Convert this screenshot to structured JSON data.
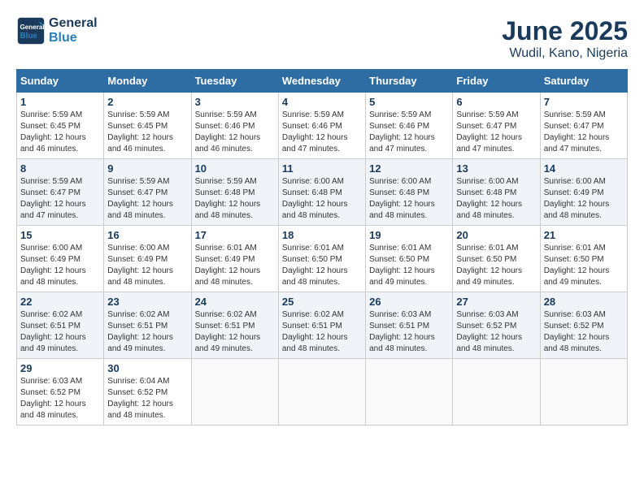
{
  "header": {
    "logo_line1": "General",
    "logo_line2": "Blue",
    "title": "June 2025",
    "subtitle": "Wudil, Kano, Nigeria"
  },
  "weekdays": [
    "Sunday",
    "Monday",
    "Tuesday",
    "Wednesday",
    "Thursday",
    "Friday",
    "Saturday"
  ],
  "weeks": [
    [
      {
        "day": "1",
        "sunrise": "5:59 AM",
        "sunset": "6:45 PM",
        "daylight": "12 hours and 46 minutes."
      },
      {
        "day": "2",
        "sunrise": "5:59 AM",
        "sunset": "6:45 PM",
        "daylight": "12 hours and 46 minutes."
      },
      {
        "day": "3",
        "sunrise": "5:59 AM",
        "sunset": "6:46 PM",
        "daylight": "12 hours and 46 minutes."
      },
      {
        "day": "4",
        "sunrise": "5:59 AM",
        "sunset": "6:46 PM",
        "daylight": "12 hours and 47 minutes."
      },
      {
        "day": "5",
        "sunrise": "5:59 AM",
        "sunset": "6:46 PM",
        "daylight": "12 hours and 47 minutes."
      },
      {
        "day": "6",
        "sunrise": "5:59 AM",
        "sunset": "6:47 PM",
        "daylight": "12 hours and 47 minutes."
      },
      {
        "day": "7",
        "sunrise": "5:59 AM",
        "sunset": "6:47 PM",
        "daylight": "12 hours and 47 minutes."
      }
    ],
    [
      {
        "day": "8",
        "sunrise": "5:59 AM",
        "sunset": "6:47 PM",
        "daylight": "12 hours and 47 minutes."
      },
      {
        "day": "9",
        "sunrise": "5:59 AM",
        "sunset": "6:47 PM",
        "daylight": "12 hours and 48 minutes."
      },
      {
        "day": "10",
        "sunrise": "5:59 AM",
        "sunset": "6:48 PM",
        "daylight": "12 hours and 48 minutes."
      },
      {
        "day": "11",
        "sunrise": "6:00 AM",
        "sunset": "6:48 PM",
        "daylight": "12 hours and 48 minutes."
      },
      {
        "day": "12",
        "sunrise": "6:00 AM",
        "sunset": "6:48 PM",
        "daylight": "12 hours and 48 minutes."
      },
      {
        "day": "13",
        "sunrise": "6:00 AM",
        "sunset": "6:48 PM",
        "daylight": "12 hours and 48 minutes."
      },
      {
        "day": "14",
        "sunrise": "6:00 AM",
        "sunset": "6:49 PM",
        "daylight": "12 hours and 48 minutes."
      }
    ],
    [
      {
        "day": "15",
        "sunrise": "6:00 AM",
        "sunset": "6:49 PM",
        "daylight": "12 hours and 48 minutes."
      },
      {
        "day": "16",
        "sunrise": "6:00 AM",
        "sunset": "6:49 PM",
        "daylight": "12 hours and 48 minutes."
      },
      {
        "day": "17",
        "sunrise": "6:01 AM",
        "sunset": "6:49 PM",
        "daylight": "12 hours and 48 minutes."
      },
      {
        "day": "18",
        "sunrise": "6:01 AM",
        "sunset": "6:50 PM",
        "daylight": "12 hours and 48 minutes."
      },
      {
        "day": "19",
        "sunrise": "6:01 AM",
        "sunset": "6:50 PM",
        "daylight": "12 hours and 49 minutes."
      },
      {
        "day": "20",
        "sunrise": "6:01 AM",
        "sunset": "6:50 PM",
        "daylight": "12 hours and 49 minutes."
      },
      {
        "day": "21",
        "sunrise": "6:01 AM",
        "sunset": "6:50 PM",
        "daylight": "12 hours and 49 minutes."
      }
    ],
    [
      {
        "day": "22",
        "sunrise": "6:02 AM",
        "sunset": "6:51 PM",
        "daylight": "12 hours and 49 minutes."
      },
      {
        "day": "23",
        "sunrise": "6:02 AM",
        "sunset": "6:51 PM",
        "daylight": "12 hours and 49 minutes."
      },
      {
        "day": "24",
        "sunrise": "6:02 AM",
        "sunset": "6:51 PM",
        "daylight": "12 hours and 49 minutes."
      },
      {
        "day": "25",
        "sunrise": "6:02 AM",
        "sunset": "6:51 PM",
        "daylight": "12 hours and 48 minutes."
      },
      {
        "day": "26",
        "sunrise": "6:03 AM",
        "sunset": "6:51 PM",
        "daylight": "12 hours and 48 minutes."
      },
      {
        "day": "27",
        "sunrise": "6:03 AM",
        "sunset": "6:52 PM",
        "daylight": "12 hours and 48 minutes."
      },
      {
        "day": "28",
        "sunrise": "6:03 AM",
        "sunset": "6:52 PM",
        "daylight": "12 hours and 48 minutes."
      }
    ],
    [
      {
        "day": "29",
        "sunrise": "6:03 AM",
        "sunset": "6:52 PM",
        "daylight": "12 hours and 48 minutes."
      },
      {
        "day": "30",
        "sunrise": "6:04 AM",
        "sunset": "6:52 PM",
        "daylight": "12 hours and 48 minutes."
      },
      null,
      null,
      null,
      null,
      null
    ]
  ]
}
